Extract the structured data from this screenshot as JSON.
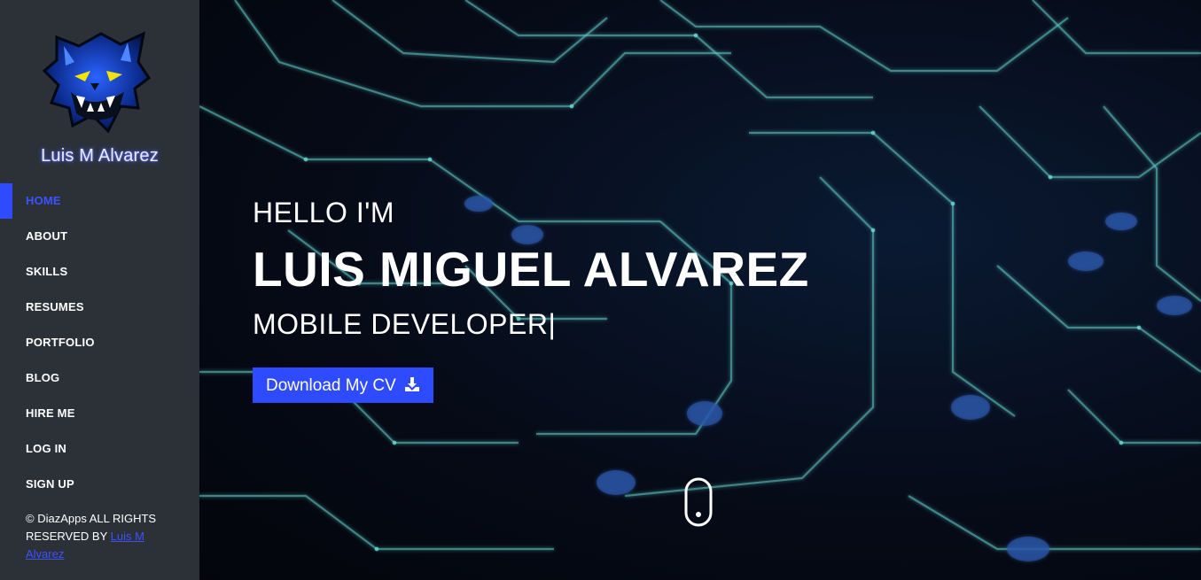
{
  "sidebar": {
    "logo_icon": "panther-logo-icon",
    "brand_name": "Luis M Alvarez",
    "nav": [
      {
        "label": "HOME",
        "active": true
      },
      {
        "label": "ABOUT"
      },
      {
        "label": "SKILLS"
      },
      {
        "label": "RESUMES"
      },
      {
        "label": "PORTFOLIO"
      },
      {
        "label": "BLOG"
      },
      {
        "label": "HIRE ME"
      },
      {
        "label": "LOG IN"
      },
      {
        "label": "SIGN UP"
      }
    ],
    "copyright_text": "© DiazApps ALL RIGHTS RESERVED BY ",
    "copyright_author": "Luis M Alvarez"
  },
  "hero": {
    "greeting": "HELLO I'M",
    "name": "LUIS MIGUEL ALVAREZ",
    "role": "MOBILE  DEVELOPER",
    "cursor": "|",
    "cta_label": "Download My CV",
    "cta_icon": "download-icon",
    "scroll_icon": "mouse-scroll-icon",
    "background": "circuit-board-image"
  },
  "colors": {
    "sidebar_bg": "#2c3138",
    "accent": "#2f4bff",
    "active_text": "#3d52ff",
    "hero_bg": "#05070f",
    "circuit": "#5fc9c4"
  }
}
